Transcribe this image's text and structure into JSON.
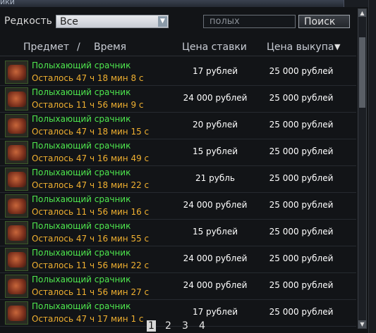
{
  "window": {
    "title": "ики"
  },
  "filters": {
    "rarity_label": "Редкость",
    "rarity_value": "Все",
    "search_placeholder": "полых",
    "search_button": "Поиск"
  },
  "columns": {
    "item": "Предмет",
    "sep": "/",
    "time": "Время",
    "bid": "Цена ставки",
    "buyout": "Цена выкупа",
    "sort_indicator": "▼"
  },
  "rows": [
    {
      "name": "Полыхающий срачник",
      "time": "Осталось 47 ч 18 мин 8 с",
      "bid": "17 рублей",
      "buyout": "25 000 рублей"
    },
    {
      "name": "Полыхающий срачник",
      "time": "Осталось 11 ч 56 мин 9 с",
      "bid": "24 000 рублей",
      "buyout": "25 000 рублей"
    },
    {
      "name": "Полыхающий срачник",
      "time": "Осталось 47 ч 18 мин 15 с",
      "bid": "20 рублей",
      "buyout": "25 000 рублей"
    },
    {
      "name": "Полыхающий срачник",
      "time": "Осталось 47 ч 16 мин 49 с",
      "bid": "15 рублей",
      "buyout": "25 000 рублей"
    },
    {
      "name": "Полыхающий срачник",
      "time": "Осталось 47 ч 18 мин 22 с",
      "bid": "21 рубль",
      "buyout": "25 000 рублей"
    },
    {
      "name": "Полыхающий срачник",
      "time": "Осталось 11 ч 56 мин 16 с",
      "bid": "24 000 рублей",
      "buyout": "25 000 рублей"
    },
    {
      "name": "Полыхающий срачник",
      "time": "Осталось 47 ч 16 мин 55 с",
      "bid": "15 рублей",
      "buyout": "25 000 рублей"
    },
    {
      "name": "Полыхающий срачник",
      "time": "Осталось 11 ч 56 мин 22 с",
      "bid": "24 000 рублей",
      "buyout": "25 000 рублей"
    },
    {
      "name": "Полыхающий срачник",
      "time": "Осталось 11 ч 56 мин 27 с",
      "bid": "24 000 рублей",
      "buyout": "25 000 рублей"
    },
    {
      "name": "Полыхающий срачник",
      "time": "Осталось 47 ч 17 мин 1 с",
      "bid": "17 рублей",
      "buyout": "25 000 рублей"
    }
  ],
  "pagination": {
    "pages": [
      "1",
      "2",
      "3",
      "4"
    ],
    "current": "1"
  },
  "colors": {
    "item_name": "#4ee84e",
    "time_left": "#f0b030",
    "background": "#121417"
  },
  "icons": {
    "item_icon": "item-icon",
    "sort": "sort-desc-icon",
    "dropdown": "chevron-down-icon"
  }
}
